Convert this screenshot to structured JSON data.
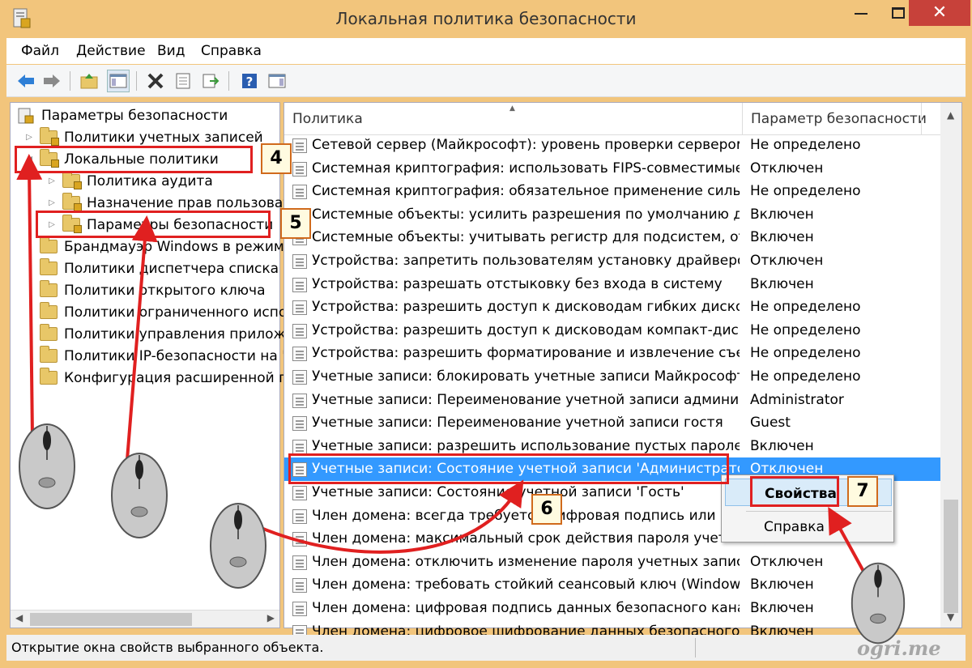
{
  "window": {
    "title": "Локальная политика безопасности"
  },
  "menu": {
    "items": [
      "Файл",
      "Действие",
      "Вид",
      "Справка"
    ]
  },
  "toolbar": {
    "icons": [
      "back-arrow-icon",
      "forward-arrow-icon",
      "up-folder-icon",
      "show-tree-icon",
      "delete-icon",
      "properties-icon",
      "export-icon",
      "help-icon",
      "console-icon"
    ]
  },
  "tree": {
    "root": "Параметры безопасности",
    "items": [
      {
        "label": "Политики учетных записей",
        "level": 1
      },
      {
        "label": "Локальные политики",
        "level": 1
      },
      {
        "label": "Политика аудита",
        "level": 2
      },
      {
        "label": "Назначение прав пользовате",
        "level": 2
      },
      {
        "label": "Параметры безопасности",
        "level": 2
      },
      {
        "label": "Брандмауэр Windows в режиме",
        "level": 1
      },
      {
        "label": "Политики диспетчера списка се",
        "level": 1
      },
      {
        "label": "Политики открытого ключа",
        "level": 1
      },
      {
        "label": "Политики ограниченного испо",
        "level": 1
      },
      {
        "label": "Политики управления приложе",
        "level": 1
      },
      {
        "label": "Политики IP-безопасности на \"Л",
        "level": 1
      },
      {
        "label": "Конфигурация расширенной по",
        "level": 1
      }
    ]
  },
  "table": {
    "headers": {
      "policy": "Политика",
      "param": "Параметр безопасности"
    },
    "rows": [
      {
        "policy": "Сетевой сервер (Майкрософт): уровень проверки сервером и...",
        "value": "Не определено"
      },
      {
        "policy": "Системная криптография: использовать FIPS-совместимые а...",
        "value": "Отключен"
      },
      {
        "policy": "Системная криптография: обязательное применение сильно...",
        "value": "Не определено"
      },
      {
        "policy": "Системные объекты: усилить разрешения по умолчанию для...",
        "value": "Включен"
      },
      {
        "policy": "Системные объекты: учитывать регистр для подсистем, отли...",
        "value": "Включен"
      },
      {
        "policy": "Устройства: запретить пользователям установку драйверов п...",
        "value": "Отключен"
      },
      {
        "policy": "Устройства: разрешать отстыковку без входа в систему",
        "value": "Включен"
      },
      {
        "policy": "Устройства: разрешить доступ к дисководам гибких дисков то...",
        "value": "Не определено"
      },
      {
        "policy": "Устройства: разрешить доступ к дисководам компакт-дисков ...",
        "value": "Не определено"
      },
      {
        "policy": "Устройства: разрешить форматирование и извлечение съемн...",
        "value": "Не определено"
      },
      {
        "policy": "Учетные записи: блокировать учетные записи Майкрософт",
        "value": "Не определено"
      },
      {
        "policy": "Учетные записи: Переименование учетной записи администр...",
        "value": "Administrator"
      },
      {
        "policy": "Учетные записи: Переименование учетной записи гостя",
        "value": "Guest"
      },
      {
        "policy": "Учетные записи: разрешить использование пустых паролей т...",
        "value": "Включен"
      },
      {
        "policy": "Учетные записи: Состояние учетной записи 'Администратор'",
        "value": "Отключен",
        "selected": true
      },
      {
        "policy": "Учетные записи: Состояние учетной записи 'Гость'",
        "value": ""
      },
      {
        "policy": "Член домена: всегда требуется цифровая подпись или шифр...",
        "value": ""
      },
      {
        "policy": "Член домена: максимальный срок действия пароля учетных ...",
        "value": ""
      },
      {
        "policy": "Член домена: отключить изменение пароля учетных записей ...",
        "value": "Отключен"
      },
      {
        "policy": "Член домена: требовать стойкий сеансовый ключ (Windows 2...",
        "value": "Включен"
      },
      {
        "policy": "Член домена: цифровая подпись данных безопасного канала,...",
        "value": "Включен"
      },
      {
        "policy": "Член домена: цифровое шифрование данных безопасного кан...",
        "value": "Включен"
      }
    ]
  },
  "context_menu": {
    "items": [
      "Свойства",
      "Справка"
    ]
  },
  "status": {
    "text": "Открытие окна свойств выбранного объекта."
  },
  "watermark": "ogri.me",
  "annotations": {
    "steps": [
      "4",
      "5",
      "6",
      "7"
    ],
    "color": "#e02020"
  }
}
